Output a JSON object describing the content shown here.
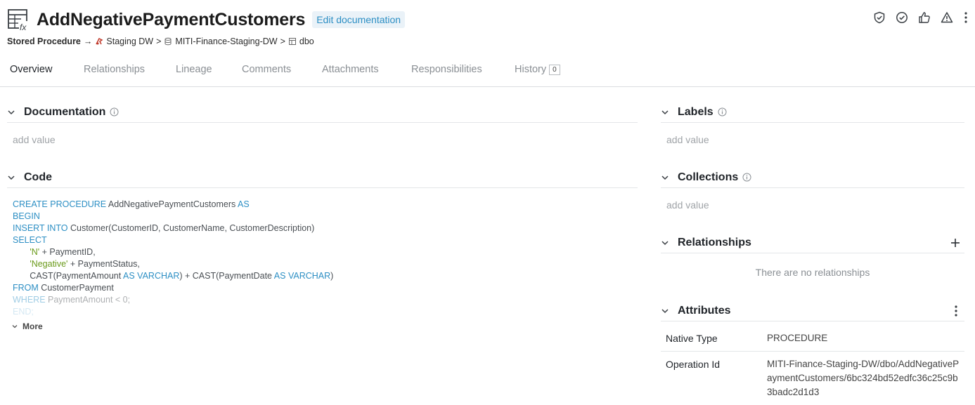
{
  "header": {
    "title": "AddNegativePaymentCustomers",
    "edit_doc_label": "Edit documentation"
  },
  "breadcrumb": {
    "type": "Stored Procedure",
    "arrow": "→",
    "items": [
      "Staging DW",
      "MITI-Finance-Staging-DW",
      "dbo"
    ],
    "sep": ">"
  },
  "tabs": [
    {
      "label": "Overview",
      "active": true
    },
    {
      "label": "Relationships"
    },
    {
      "label": "Lineage"
    },
    {
      "label": "Comments"
    },
    {
      "label": "Attachments"
    },
    {
      "label": "Responsibilities"
    },
    {
      "label": "History",
      "count": "0"
    }
  ],
  "documentation": {
    "title": "Documentation",
    "value": "add value"
  },
  "code": {
    "title": "Code",
    "more_label": "More",
    "lines": [
      [
        {
          "k": "CREATE PROCEDURE"
        },
        {
          "t": " AddNegativePaymentCustomers "
        },
        {
          "k": "AS"
        }
      ],
      [
        {
          "k": "BEGIN"
        }
      ],
      [
        {
          "k": "INSERT INTO"
        },
        {
          "t": " Customer(CustomerID, CustomerName, CustomerDescription)"
        }
      ],
      [
        {
          "k": "SELECT"
        }
      ],
      [
        {
          "t": "       "
        },
        {
          "s": "'N'"
        },
        {
          "t": " + PaymentID,"
        }
      ],
      [
        {
          "t": "       "
        },
        {
          "s": "'Negative'"
        },
        {
          "t": " + PaymentStatus,"
        }
      ],
      [
        {
          "t": "       CAST(PaymentAmount "
        },
        {
          "k": "AS VARCHAR"
        },
        {
          "t": ") + CAST(PaymentDate "
        },
        {
          "k": "AS VARCHAR"
        },
        {
          "t": ")"
        }
      ],
      [
        {
          "k": "FROM"
        },
        {
          "t": " CustomerPayment"
        }
      ],
      [
        {
          "k": "WHERE"
        },
        {
          "t": " PaymentAmount < 0;"
        }
      ],
      [
        {
          "k": "END;"
        }
      ]
    ]
  },
  "labels": {
    "title": "Labels",
    "value": "add value"
  },
  "collections": {
    "title": "Collections",
    "value": "add value"
  },
  "relationships": {
    "title": "Relationships",
    "empty": "There are no relationships"
  },
  "attributes": {
    "title": "Attributes",
    "rows": [
      {
        "key": "Native Type",
        "value": "PROCEDURE"
      },
      {
        "key": "Operation Id",
        "value": "MITI-Finance-Staging-DW/dbo/AddNegativePaymentCustomers/6bc324bd52edfc36c25c9b3badc2d1d3"
      }
    ]
  },
  "colors": {
    "accent": "#2d8fc4",
    "string": "#6a9a1a",
    "muted": "#a0a4a8"
  }
}
